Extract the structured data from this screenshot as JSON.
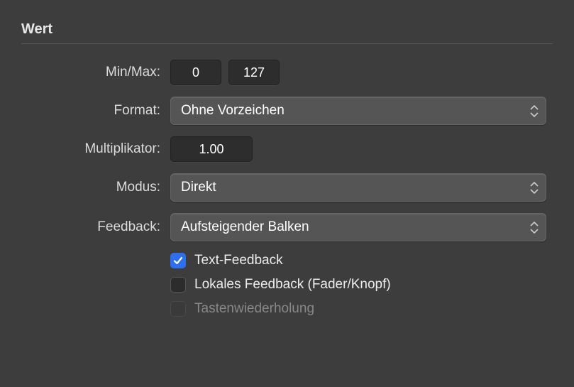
{
  "section_title": "Wert",
  "minmax": {
    "label": "Min/Max:",
    "min": "0",
    "max": "127"
  },
  "format": {
    "label": "Format:",
    "value": "Ohne Vorzeichen"
  },
  "multiplikator": {
    "label": "Multiplikator:",
    "value": "1.00"
  },
  "modus": {
    "label": "Modus:",
    "value": "Direkt"
  },
  "feedback": {
    "label": "Feedback:",
    "value": "Aufsteigender Balken"
  },
  "checkboxes": {
    "text_feedback": {
      "label": "Text-Feedback",
      "checked": true,
      "enabled": true
    },
    "lokales_feedback": {
      "label": "Lokales Feedback (Fader/Knopf)",
      "checked": false,
      "enabled": true
    },
    "tastenwiederholung": {
      "label": "Tastenwiederholung",
      "checked": false,
      "enabled": false
    }
  }
}
